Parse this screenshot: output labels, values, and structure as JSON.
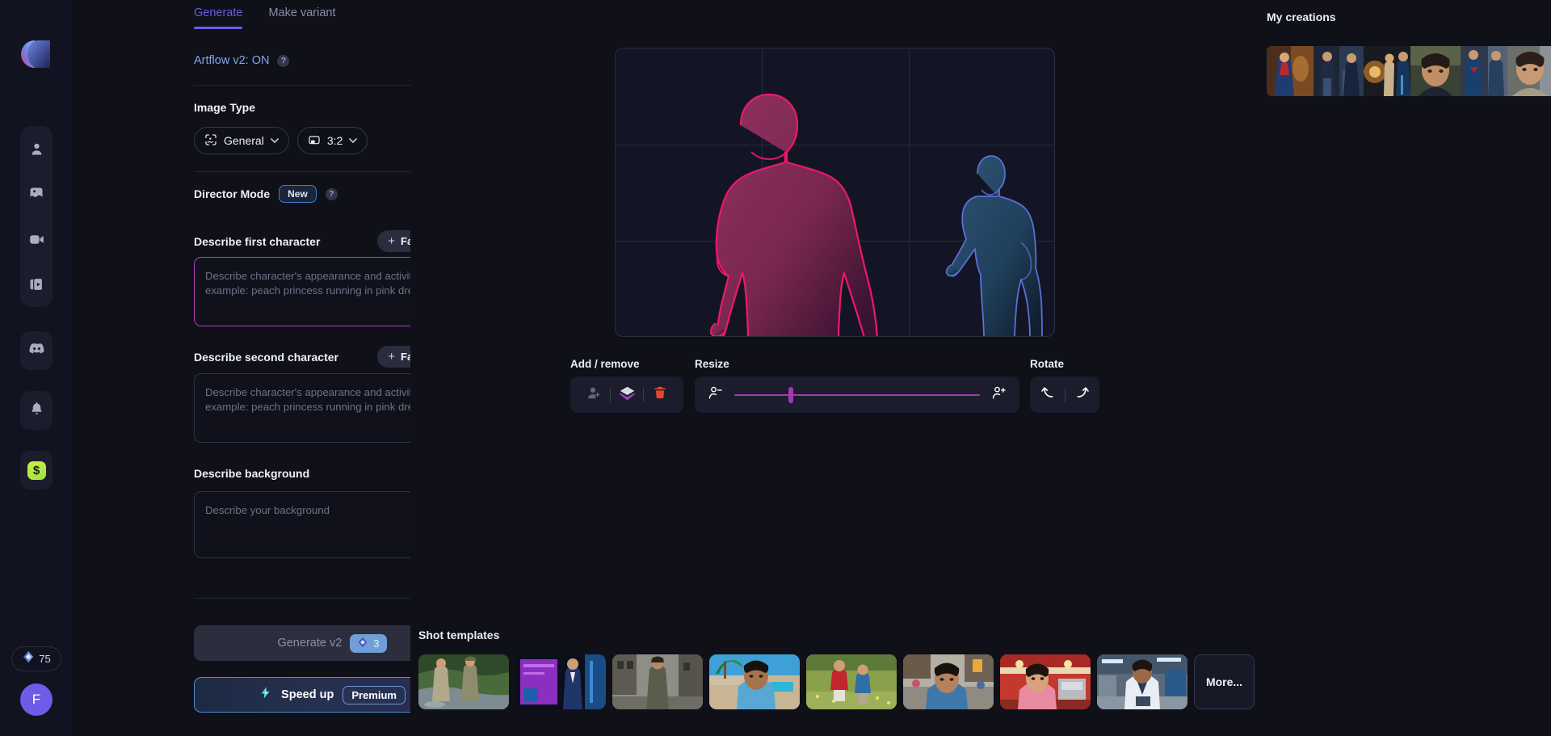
{
  "rail": {
    "logo_name": "artflow-logo",
    "nav_items": [
      {
        "name": "sidebar-item-characters",
        "icon": "person-icon"
      },
      {
        "name": "sidebar-item-images",
        "icon": "image-icon"
      },
      {
        "name": "sidebar-item-video",
        "icon": "video-camera-icon"
      },
      {
        "name": "sidebar-item-library",
        "icon": "media-library-icon"
      }
    ],
    "discord": {
      "icon": "discord-icon"
    },
    "bell": {
      "icon": "bell-icon"
    },
    "money": {
      "icon": "dollar-icon"
    },
    "credits_value": "75",
    "credits_icon": "gem-icon",
    "avatar_initial": "F"
  },
  "tabs": [
    {
      "label": "Generate",
      "active": true
    },
    {
      "label": "Make variant",
      "active": false
    }
  ],
  "artflow": {
    "label": "Artflow v2: ON",
    "help_icon": "question-mark-icon",
    "toggle_on": true
  },
  "image_type": {
    "label": "Image Type",
    "style_value": "General",
    "style_icon": "focus-person-icon",
    "ratio_value": "3:2",
    "ratio_icon": "aspect-ratio-icon"
  },
  "director_mode": {
    "label": "Director Mode",
    "badge": "New",
    "help_icon": "question-mark-icon",
    "toggle_on": true
  },
  "first_character": {
    "label": "Describe first character",
    "button_label": "Face / Body",
    "button_plus": "+",
    "placeholder": "Describe character's appearance and activity, for example: peach princess running in pink dress",
    "value": "",
    "focused": true
  },
  "second_character": {
    "label": "Describe second character",
    "button_label": "Face / Body",
    "button_plus": "+",
    "placeholder": "Describe character's appearance and activity, for example: peach princess running in pink dress",
    "value": "",
    "focused": false
  },
  "background": {
    "label": "Describe background",
    "placeholder": "Describe your background",
    "value": ""
  },
  "generate": {
    "label": "Generate v2",
    "cost": "3",
    "cost_icon": "gem-icon"
  },
  "speed_up": {
    "label": "Speed up",
    "badge": "Premium",
    "icon": "lightning-bolt-icon"
  },
  "canvas": {
    "grid_columns": 3,
    "grid_rows": 3,
    "figures": [
      {
        "name": "character-1-figure",
        "color": "#f0176a",
        "fill": "#8c2a58",
        "selected": true
      },
      {
        "name": "character-2-figure",
        "color": "#5b6fd8",
        "fill": "#23405e",
        "selected": false
      }
    ]
  },
  "toolbar": {
    "add_remove": {
      "label": "Add / remove",
      "buttons": [
        {
          "name": "add-person-button",
          "icon": "person-plus-icon"
        },
        {
          "name": "duplicate-layer-button",
          "icon": "layers-icon"
        },
        {
          "name": "delete-button",
          "icon": "trash-icon"
        }
      ]
    },
    "resize": {
      "label": "Resize",
      "icon_min": "person-minus-icon",
      "icon_max": "person-plus-icon",
      "value_percent": 22
    },
    "rotate": {
      "label": "Rotate",
      "buttons": [
        {
          "name": "rotate-left-button",
          "icon": "rotate-left-icon"
        },
        {
          "name": "rotate-right-button",
          "icon": "rotate-right-icon"
        }
      ]
    }
  },
  "creations": {
    "title": "My creations",
    "items": [
      {
        "name": "creation-thumb-1"
      },
      {
        "name": "creation-thumb-2"
      },
      {
        "name": "creation-thumb-3"
      },
      {
        "name": "creation-thumb-4"
      },
      {
        "name": "creation-thumb-5"
      },
      {
        "name": "creation-thumb-6"
      }
    ]
  },
  "shot_templates": {
    "title": "Shot templates",
    "more_label": "More...",
    "items": [
      {
        "name": "shot-template-river-explorers"
      },
      {
        "name": "shot-template-neon-presenter"
      },
      {
        "name": "shot-template-postapocalyptic-street"
      },
      {
        "name": "shot-template-tropical-selfie"
      },
      {
        "name": "shot-template-meadow-walk"
      },
      {
        "name": "shot-template-city-street-portrait"
      },
      {
        "name": "shot-template-retro-diner"
      },
      {
        "name": "shot-template-lab-scientist"
      }
    ]
  }
}
